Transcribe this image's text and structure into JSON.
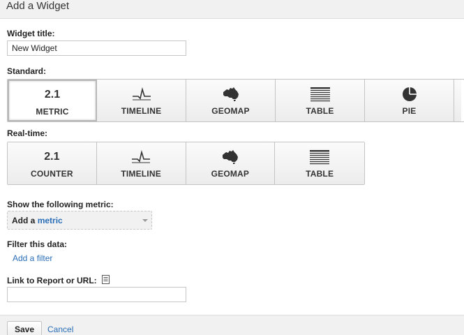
{
  "dialog": {
    "title": "Add a Widget"
  },
  "widget_title": {
    "label": "Widget title:",
    "value": "New Widget"
  },
  "standard": {
    "label": "Standard:",
    "buttons": [
      {
        "icon": "metric-number-icon",
        "icon_text": "2.1",
        "label": "METRIC"
      },
      {
        "icon": "timeline-icon",
        "label": "TIMELINE"
      },
      {
        "icon": "geomap-icon",
        "label": "GEOMAP"
      },
      {
        "icon": "table-icon",
        "label": "TABLE"
      },
      {
        "icon": "pie-icon",
        "label": "PIE"
      }
    ],
    "selected": "METRIC"
  },
  "realtime": {
    "label": "Real-time:",
    "buttons": [
      {
        "icon": "counter-number-icon",
        "icon_text": "2.1",
        "label": "COUNTER"
      },
      {
        "icon": "timeline-icon",
        "label": "TIMELINE"
      },
      {
        "icon": "geomap-icon",
        "label": "GEOMAP"
      },
      {
        "icon": "table-icon",
        "label": "TABLE"
      }
    ]
  },
  "metric": {
    "label": "Show the following metric:",
    "prefix": "Add a",
    "link": "metric"
  },
  "filter": {
    "label": "Filter this data:",
    "link": "Add a filter"
  },
  "report_link": {
    "label": "Link to Report or URL:",
    "icon": "report-page-icon",
    "value": ""
  },
  "footer": {
    "save": "Save",
    "cancel": "Cancel"
  },
  "colors": {
    "link": "#2a6eb8",
    "header_bg": "#f1f1f1",
    "border": "#c4c4c4"
  }
}
